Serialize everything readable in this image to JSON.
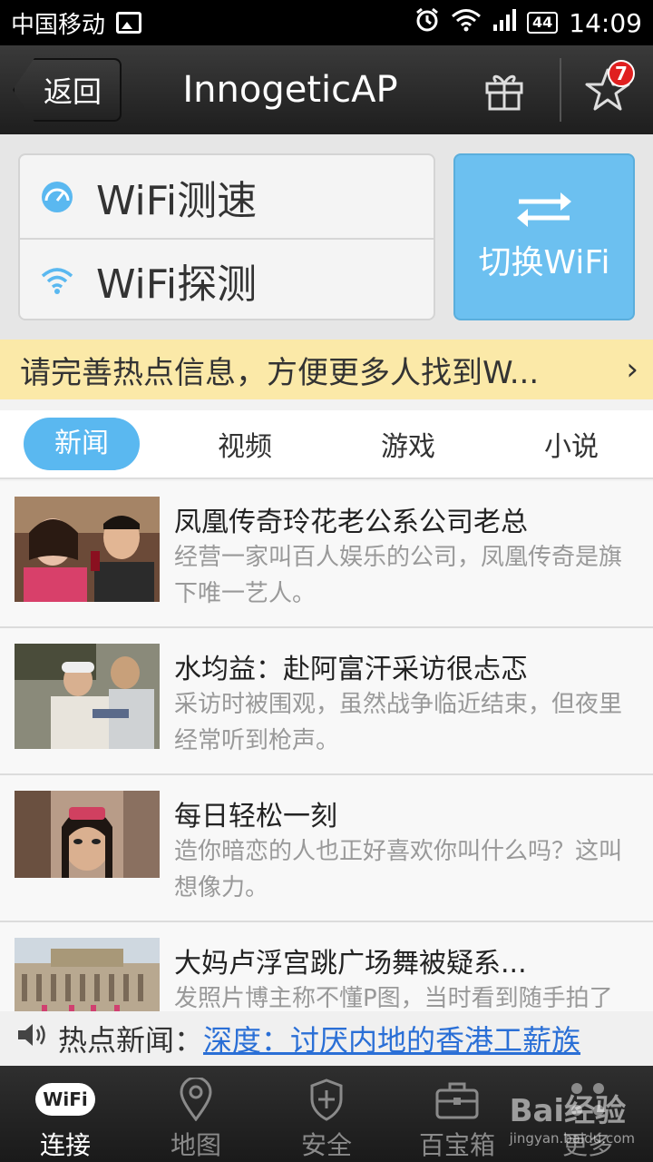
{
  "status_bar": {
    "carrier": "中国移动",
    "battery": "44",
    "time": "14:09"
  },
  "header": {
    "back_label": "返回",
    "title": "InnogeticAP",
    "star_badge": "7"
  },
  "wifi_panel": {
    "speed_test_label": "WiFi测速",
    "detect_label": "WiFi探测",
    "switch_label": "切换WiFi"
  },
  "tip": {
    "text": "请完善热点信息，方便更多人找到W..."
  },
  "tabs": [
    {
      "label": "新闻",
      "active": true
    },
    {
      "label": "视频",
      "active": false
    },
    {
      "label": "游戏",
      "active": false
    },
    {
      "label": "小说",
      "active": false
    }
  ],
  "news": [
    {
      "title": "凤凰传奇玲花老公系公司老总",
      "desc": "经营一家叫百人娱乐的公司，凤凰传奇是旗下唯一艺人。"
    },
    {
      "title": "水均益：赴阿富汗采访很忐忑",
      "desc": "采访时被围观，虽然战争临近结束，但夜里经常听到枪声。"
    },
    {
      "title": "每日轻松一刻",
      "desc": "造你暗恋的人也正好喜欢你叫什么吗？这叫想像力。"
    },
    {
      "title": "大妈卢浮宫跳广场舞被疑系...",
      "desc": "发照片博主称不懂P图，当时看到随手拍了"
    }
  ],
  "ticker": {
    "prefix": "热点新闻：",
    "link": "深度：讨厌内地的香港工薪族"
  },
  "bottom_nav": {
    "items": [
      {
        "label": "连接",
        "icon": "wifi-badge-icon",
        "active": true
      },
      {
        "label": "地图",
        "icon": "map-pin-icon",
        "active": false
      },
      {
        "label": "安全",
        "icon": "shield-icon",
        "active": false
      },
      {
        "label": "百宝箱",
        "icon": "toolbox-icon",
        "active": false
      },
      {
        "label": "更多",
        "icon": "more-icon",
        "active": false
      }
    ],
    "wifi_badge_text": "WiFi"
  },
  "watermark": {
    "brand": "Bai经验",
    "url": "jingyan.baidu.com"
  },
  "colors": {
    "accent_blue": "#5ab8f0",
    "tip_bg": "#fbe9a8",
    "badge_red": "#e02020",
    "link_blue": "#2a6fd6"
  }
}
